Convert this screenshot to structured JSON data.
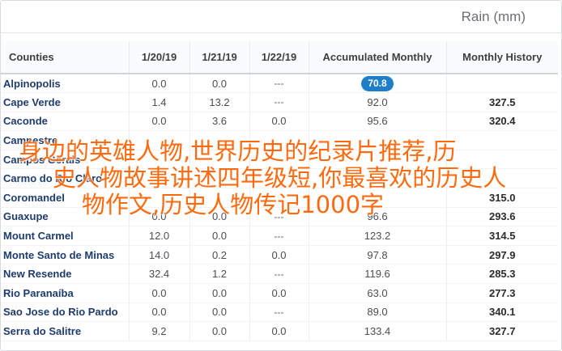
{
  "header": {
    "title": "Rain (mm)"
  },
  "table": {
    "columns": [
      "Counties",
      "1/20/19",
      "1/21/19",
      "1/22/19",
      "Accumulated Monthly",
      "Monthly History"
    ],
    "rows": [
      {
        "name": "Alpinopolis",
        "d1": "0.0",
        "d2": "0.0",
        "d3": "---",
        "acc": "70.8",
        "hist": "",
        "acc_highlight": true
      },
      {
        "name": "Cape Verde",
        "d1": "1.4",
        "d2": "13.2",
        "d3": "---",
        "acc": "92.0",
        "hist": "327.5"
      },
      {
        "name": "Caconde",
        "d1": "0.0",
        "d2": "3.6",
        "d3": "0.0",
        "acc": "95.6",
        "hist": "320.4"
      },
      {
        "name": "Campestre",
        "d1": "",
        "d2": "",
        "d3": "",
        "acc": "",
        "hist": ""
      },
      {
        "name": "Campos Gerais",
        "d1": "",
        "d2": "",
        "d3": "",
        "acc": "",
        "hist": ""
      },
      {
        "name": "Carmo do Rio Claro",
        "d1": "",
        "d2": "",
        "d3": "",
        "acc": "",
        "hist": ""
      },
      {
        "name": "Coromandel",
        "d1": "",
        "d2": "",
        "d3": "",
        "acc": "",
        "hist": "315.0"
      },
      {
        "name": "Guaxupe",
        "d1": "0.0",
        "d2": "0.0",
        "d3": "---",
        "acc": "96.6",
        "hist": "293.6"
      },
      {
        "name": "Mount Carmel",
        "d1": "12.0",
        "d2": "0.0",
        "d3": "---",
        "acc": "123.2",
        "hist": "314.5"
      },
      {
        "name": "Monte Santo de Minas",
        "d1": "14.0",
        "d2": "0.2",
        "d3": "0.0",
        "acc": "97.8",
        "hist": "297.9"
      },
      {
        "name": "New Resende",
        "d1": "32.4",
        "d2": "1.2",
        "d3": "---",
        "acc": "119.6",
        "hist": "285.3"
      },
      {
        "name": "Rio Paranaíba",
        "d1": "0.0",
        "d2": "0.0",
        "d3": "0.0",
        "acc": "63.0",
        "hist": "277.3"
      },
      {
        "name": "Sao Jose do Rio Pardo",
        "d1": "0.0",
        "d2": "0.0",
        "d3": "---",
        "acc": "89.0",
        "hist": "340.1"
      },
      {
        "name": "Serra do Salitre",
        "d1": "9.2",
        "d2": "0.0",
        "d3": "0.0",
        "acc": "133.4",
        "hist": "327.7"
      }
    ]
  },
  "overlay": {
    "line1": "身边的英雄人物,世界历史的纪录片推荐,历",
    "line2": "史人物故事讲述四年级短,你最喜欢的历史人",
    "line3": "物作文,历史人物传记1000字",
    "color": "#ff6a0f"
  },
  "colors": {
    "accent": "#1e7fc8",
    "county_text": "#1f3c6e"
  }
}
